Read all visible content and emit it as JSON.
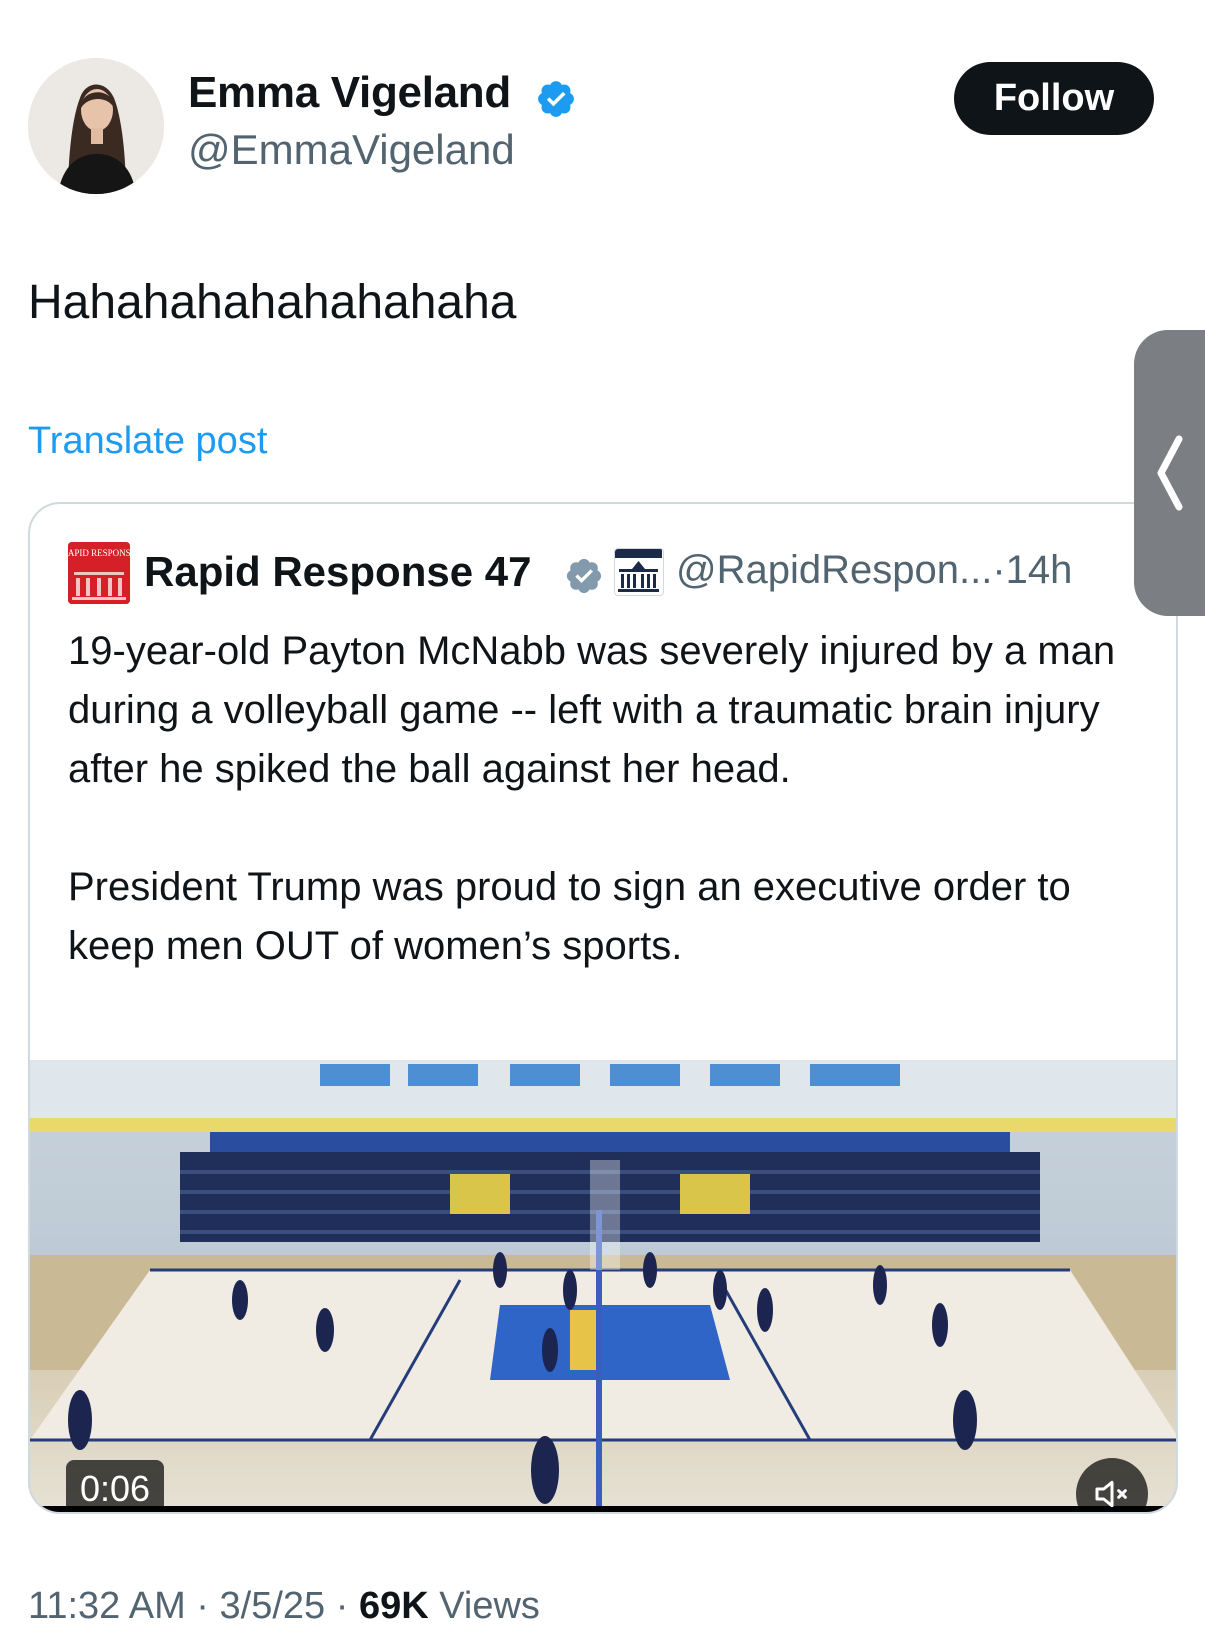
{
  "colors": {
    "accent": "#1d9bf0",
    "text_primary": "#0f1419",
    "text_secondary": "#536471",
    "verified": "#1d9bf0",
    "quote_verified": "#829aab"
  },
  "author": {
    "display_name": "Emma Vigeland",
    "handle": "@EmmaVigeland",
    "verified_icon": "verified-badge-icon",
    "follow_label": "Follow"
  },
  "tweet": {
    "text": "Hahahahahahahahaha",
    "translate_label": "Translate post"
  },
  "quote": {
    "display_name": "Rapid Response 47",
    "avatar_text": "RAPID RESPONSE",
    "handle_time": "@RapidRespon...·14h",
    "paragraph_1": "19-year-old Payton McNabb was severely injured by a man during a volleyball game -- left with a traumatic brain injury after he spiked the ball against her head.",
    "paragraph_2": "President Trump was proud to sign an executive order to keep men OUT of women’s sports.",
    "video": {
      "duration": "0:06",
      "mute_icon": "muted-speaker-icon"
    }
  },
  "meta": {
    "time": "11:32 AM",
    "separator": "·",
    "date": "3/5/25",
    "views_count": "69K",
    "views_label": "Views"
  },
  "side_tab": {
    "icon": "chevron-left-icon"
  }
}
